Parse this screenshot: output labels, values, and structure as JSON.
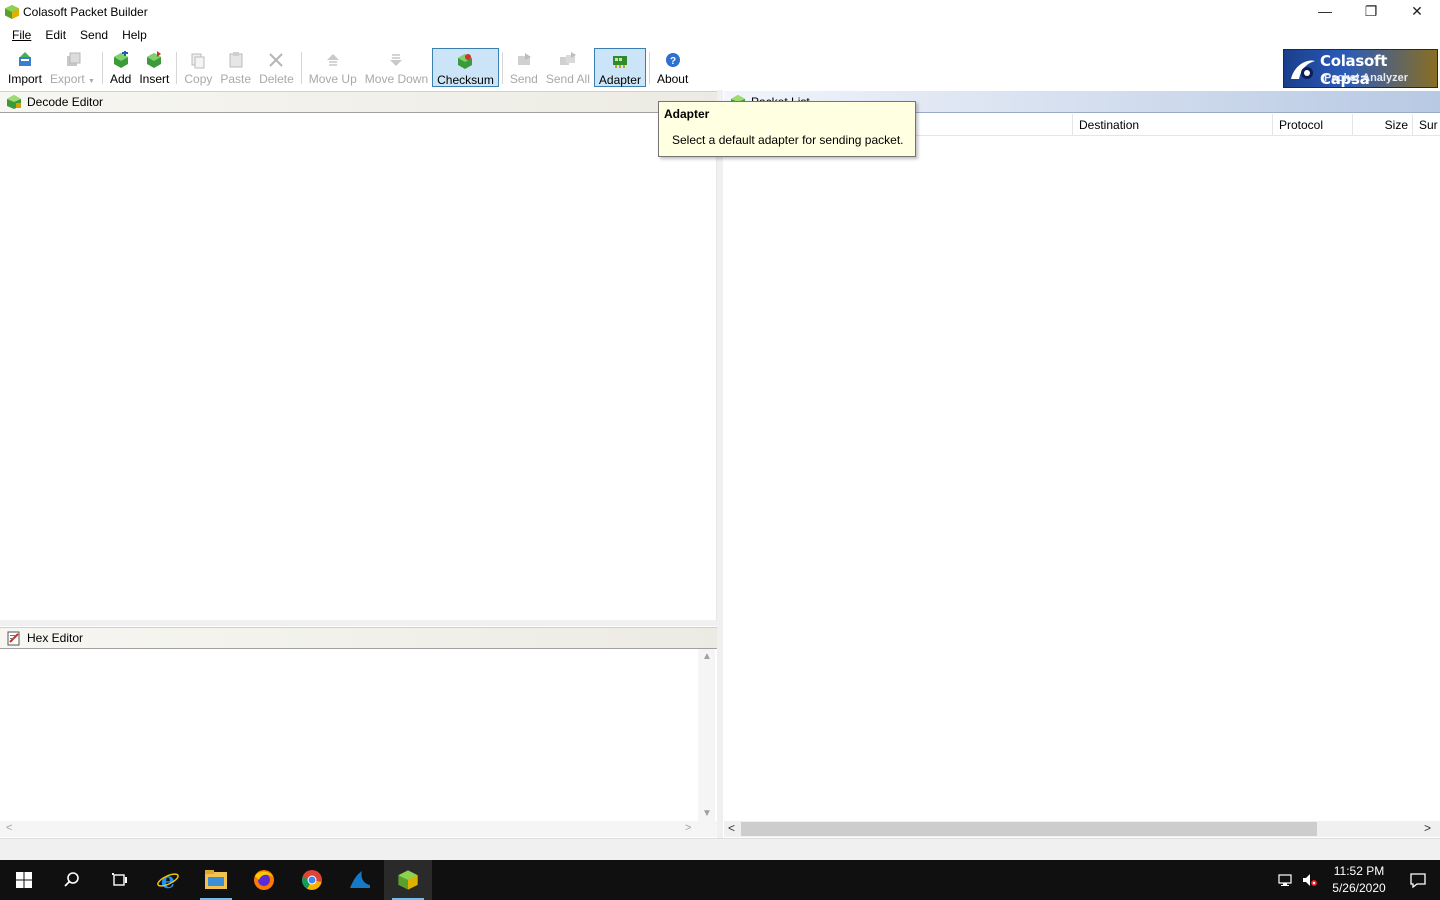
{
  "window": {
    "title": "Colasoft Packet Builder",
    "minimize": "—",
    "restore": "❐",
    "close": "✕"
  },
  "menu": {
    "file": "File",
    "edit": "Edit",
    "send": "Send",
    "help": "Help"
  },
  "toolbar": {
    "import": "Import",
    "export": "Export",
    "add": "Add",
    "insert": "Insert",
    "copy": "Copy",
    "paste": "Paste",
    "delete": "Delete",
    "move_up": "Move Up",
    "move_down": "Move Down",
    "checksum": "Checksum",
    "send": "Send",
    "send_all": "Send All",
    "adapter": "Adapter",
    "about": "About"
  },
  "logo": {
    "line1": "Colasoft Capsa",
    "line2": "Packet Analyzer"
  },
  "decode_editor": {
    "title": "Decode Editor"
  },
  "hex_editor": {
    "title": "Hex Editor"
  },
  "packet_list": {
    "title": "Packet List",
    "columns": [
      "Destination",
      "Protocol",
      "Size",
      "Sur"
    ]
  },
  "tooltip": {
    "title": "Adapter",
    "body": "Select a default adapter for sending packet."
  },
  "taskbar": {
    "time": "11:52 PM",
    "date": "5/26/2020"
  },
  "colors": {
    "active_button_bg": "#cce4f7",
    "tooltip_bg": "#ffffe1",
    "taskbar_bg": "#101010",
    "running_indicator": "#76b9ed"
  }
}
